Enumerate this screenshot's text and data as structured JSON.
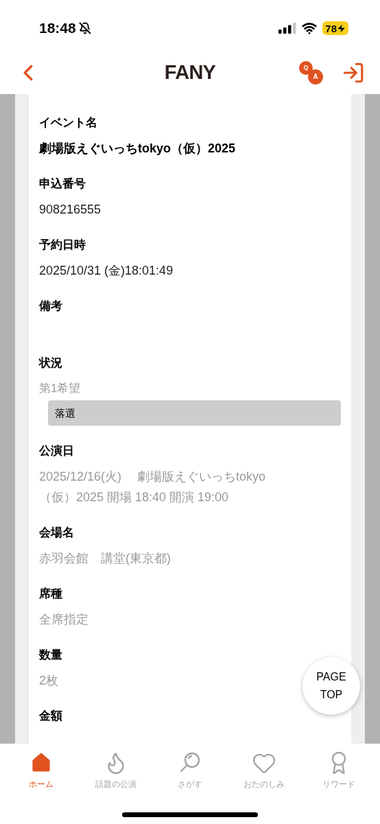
{
  "status_bar": {
    "time": "18:48",
    "battery": "78"
  },
  "header": {
    "logo": "FANY",
    "qa_letters": [
      "Q",
      "A"
    ]
  },
  "fields": [
    {
      "label": "イベント名",
      "value": "劇場版えぐいっちtokyo（仮）2025",
      "kind": "strong"
    },
    {
      "label": "申込番号",
      "value": "908216555",
      "kind": "plain"
    },
    {
      "label": "予約日時",
      "value": "2025/10/31 (金)18:01:49",
      "kind": "plain"
    },
    {
      "label": "備考",
      "kind": "empty"
    },
    {
      "label": "状況",
      "value": "第1希望",
      "result": "落選",
      "kind": "status"
    },
    {
      "label": "公演日",
      "value": "2025/12/16(火)　 劇場版えぐいっちtokyo（仮）2025 開場 18:40 開演 19:00",
      "kind": "muted"
    },
    {
      "label": "会場名",
      "value": "赤羽会館　講堂(東京都)",
      "kind": "muted"
    },
    {
      "label": "席種",
      "value": "全席指定",
      "kind": "muted"
    },
    {
      "label": "数量",
      "value": "2枚",
      "kind": "muted"
    },
    {
      "label": "金額",
      "kind": "empty"
    }
  ],
  "page_top": "PAGE TOP",
  "nav": [
    {
      "label": "ホーム",
      "selected": true
    },
    {
      "label": "話題の公演",
      "selected": false
    },
    {
      "label": "さがす",
      "selected": false
    },
    {
      "label": "おたのしみ",
      "selected": false
    },
    {
      "label": "リワード",
      "selected": false
    }
  ]
}
